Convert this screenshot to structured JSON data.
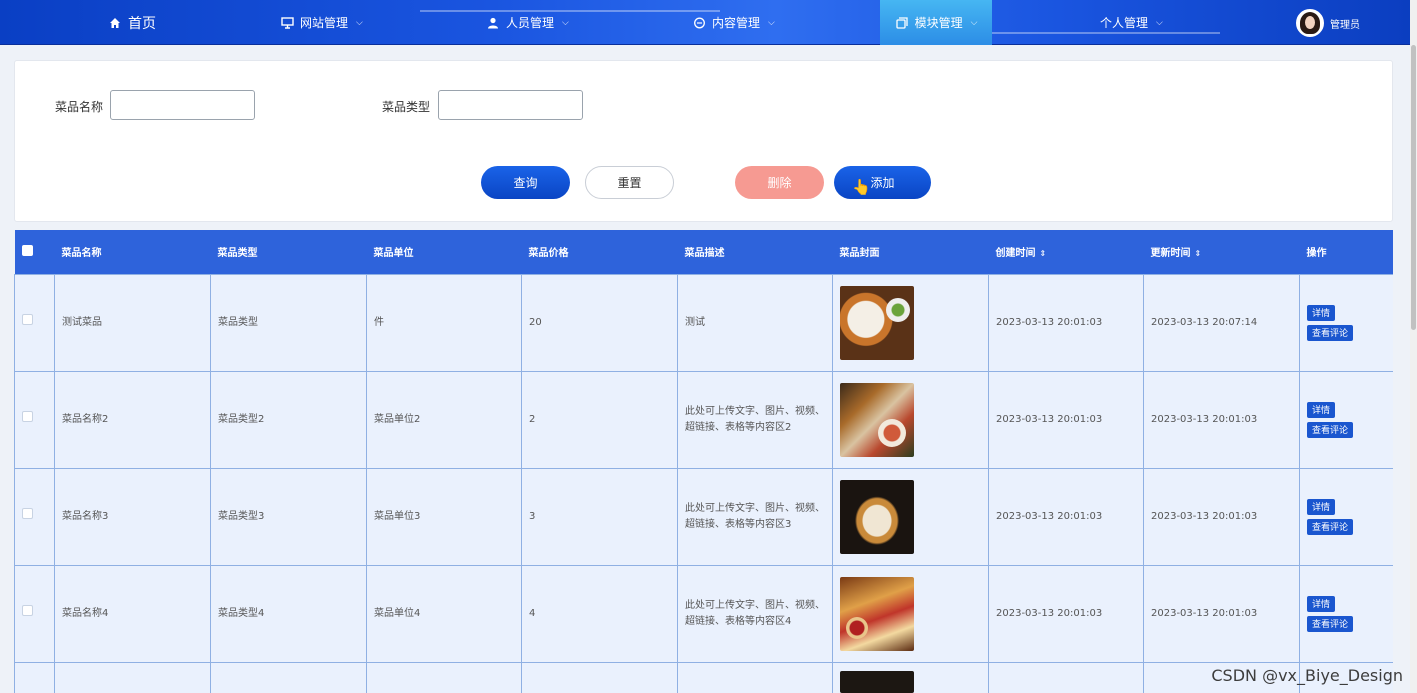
{
  "nav": {
    "home": "首页",
    "items": [
      {
        "label": "网站管理",
        "icon": "monitor-icon"
      },
      {
        "label": "人员管理",
        "icon": "person-icon"
      },
      {
        "label": "内容管理",
        "icon": "chat-icon"
      },
      {
        "label": "模块管理",
        "icon": "module-icon",
        "active": true
      },
      {
        "label": "个人管理",
        "icon": ""
      }
    ],
    "user": "管理员"
  },
  "search": {
    "name_label": "菜品名称",
    "type_label": "菜品类型",
    "name_value": "",
    "type_value": "",
    "query": "查询",
    "reset": "重置",
    "delete": "删除",
    "add": "添加"
  },
  "table": {
    "headers": [
      "菜品名称",
      "菜品类型",
      "菜品单位",
      "菜品价格",
      "菜品描述",
      "菜品封面",
      "创建时间",
      "更新时间",
      "操作"
    ],
    "rows": [
      {
        "name": "测试菜品",
        "type": "菜品类型",
        "unit": "件",
        "price": "20",
        "desc": "测试",
        "created": "2023-03-13 20:01:03",
        "updated": "2023-03-13 20:07:14"
      },
      {
        "name": "菜品名称2",
        "type": "菜品类型2",
        "unit": "菜品单位2",
        "price": "2",
        "desc": "此处可上传文字、图片、视频、超链接、表格等内容区2",
        "created": "2023-03-13 20:01:03",
        "updated": "2023-03-13 20:01:03"
      },
      {
        "name": "菜品名称3",
        "type": "菜品类型3",
        "unit": "菜品单位3",
        "price": "3",
        "desc": "此处可上传文字、图片、视频、超链接、表格等内容区3",
        "created": "2023-03-13 20:01:03",
        "updated": "2023-03-13 20:01:03"
      },
      {
        "name": "菜品名称4",
        "type": "菜品类型4",
        "unit": "菜品单位4",
        "price": "4",
        "desc": "此处可上传文字、图片、视频、超链接、表格等内容区4",
        "created": "2023-03-13 20:01:03",
        "updated": "2023-03-13 20:01:03"
      }
    ],
    "op_detail": "详情",
    "op_comments": "查看评论"
  },
  "watermark": "CSDN @vx_Biye_Design"
}
